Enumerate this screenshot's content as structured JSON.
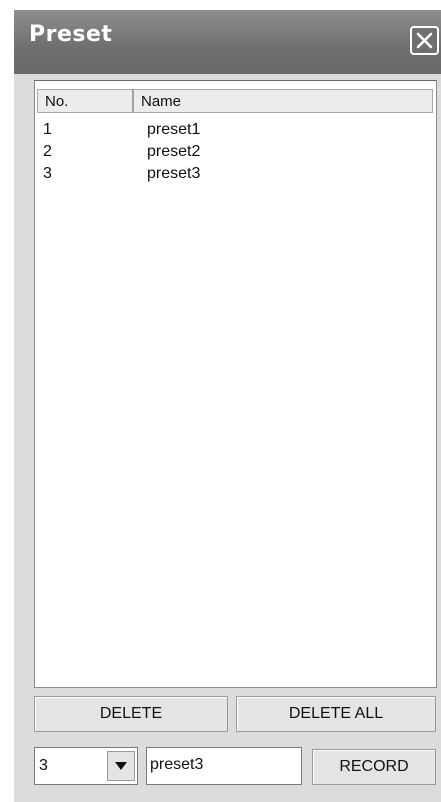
{
  "window": {
    "title": "Preset"
  },
  "list": {
    "columns": [
      "No.",
      "Name"
    ],
    "rows": [
      {
        "no": "1",
        "name": "preset1"
      },
      {
        "no": "2",
        "name": "preset2"
      },
      {
        "no": "3",
        "name": "preset3"
      }
    ]
  },
  "buttons": {
    "delete": "DELETE",
    "delete_all": "DELETE ALL",
    "record": "RECORD"
  },
  "record_bar": {
    "number_value": "3",
    "name_value": "preset3"
  },
  "icons": {
    "close": "close-icon",
    "dropdown": "chevron-down-icon"
  }
}
